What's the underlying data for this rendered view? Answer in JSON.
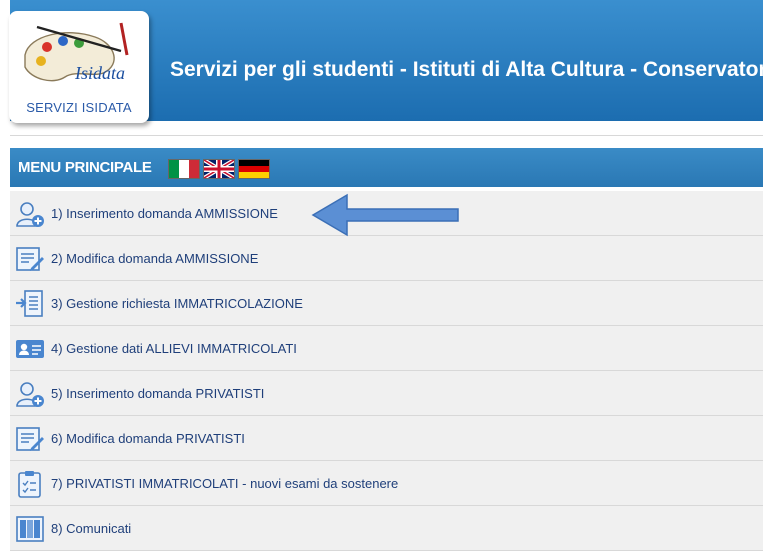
{
  "header": {
    "logo_text": "Isidata",
    "logo_caption": "SERVIZI ISIDATA",
    "title": "Servizi per gli studenti - Istituti di Alta Cultura - Conservatori",
    "band_color": "#2b7fc2"
  },
  "menu": {
    "title": "MENU PRINCIPALE",
    "bar_color": "#3385c0",
    "languages": [
      {
        "code": "it",
        "icon": "italian-flag-icon"
      },
      {
        "code": "en",
        "icon": "uk-flag-icon"
      },
      {
        "code": "de",
        "icon": "german-flag-icon"
      }
    ],
    "items": [
      {
        "label": "1) Inserimento domanda AMMISSIONE",
        "icon": "user-add-icon"
      },
      {
        "label": "2) Modifica domanda AMMISSIONE",
        "icon": "edit-form-icon"
      },
      {
        "label": "3) Gestione richiesta IMMATRICOLAZIONE",
        "icon": "document-arrow-icon"
      },
      {
        "label": "4) Gestione dati ALLIEVI IMMATRICOLATI",
        "icon": "id-card-icon"
      },
      {
        "label": "5) Inserimento domanda PRIVATISTI",
        "icon": "user-add-icon"
      },
      {
        "label": "6) Modifica domanda PRIVATISTI",
        "icon": "edit-form-icon"
      },
      {
        "label": "7) PRIVATISTI IMMATRICOLATI - nuovi esami da sostenere",
        "icon": "clipboard-check-icon"
      },
      {
        "label": "8) Comunicati",
        "icon": "notice-board-icon"
      }
    ]
  },
  "annotation": {
    "icon": "left-arrow-icon",
    "color": "#5b8fd4"
  }
}
